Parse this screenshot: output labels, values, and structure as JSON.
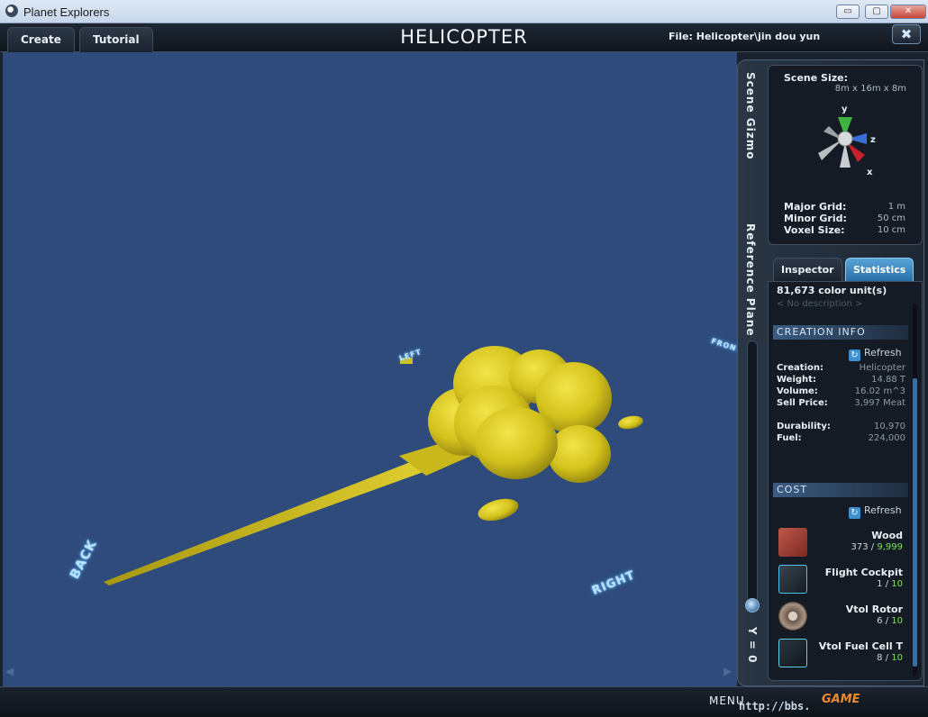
{
  "window": {
    "title": "Planet Explorers",
    "min": "▭",
    "max": "▢",
    "close": "✕"
  },
  "header": {
    "tabs": [
      "Create",
      "Tutorial"
    ],
    "title": "HELICOPTER",
    "file": "File:  Helicopter\\jin dou yun",
    "close": "✖"
  },
  "viewport": {
    "labels": {
      "back": "BACK",
      "right": "RIGHT",
      "left": "LEFT",
      "front": "FRONT"
    },
    "model_color": "#d4c21c",
    "background": "#2e4b7c"
  },
  "side_panel": {
    "vertical_labels": {
      "scene_gizmo": "Scene Gizmo",
      "reference_plane": "Reference Plane",
      "y_value": "Y = 0"
    },
    "gizmo": {
      "scene_size_label": "Scene Size:",
      "scene_size_value": "8m x 16m x 8m",
      "axes": {
        "y": "y",
        "z": "z",
        "x": "x"
      },
      "major_grid_label": "Major Grid:",
      "major_grid_value": "1 m",
      "minor_grid_label": "Minor Grid:",
      "minor_grid_value": "50 cm",
      "voxel_size_label": "Voxel Size:",
      "voxel_size_value": "10 cm"
    },
    "tabs": {
      "inspector": "Inspector",
      "statistics": "Statistics",
      "active": "statistics"
    },
    "stats": {
      "color_units": "81,673 color unit(s)",
      "description": "< No description >",
      "creation_header": "CREATION INFO",
      "refresh": "Refresh",
      "creation_label": "Creation:",
      "creation_value": "Helicopter",
      "weight_label": "Weight:",
      "weight_value": "14.88 T",
      "volume_label": "Volume:",
      "volume_value": "16.02 m^3",
      "sell_label": "Sell Price:",
      "sell_value": "3,997 Meat",
      "durability_label": "Durability:",
      "durability_value": "10,970",
      "fuel_label": "Fuel:",
      "fuel_value": "224,000",
      "cost_header": "COST",
      "cost_items": [
        {
          "name": "Wood",
          "have": "373",
          "sep": " / ",
          "need": "9,999",
          "icon": "wood-block-icon"
        },
        {
          "name": "Flight Cockpit",
          "have": "1",
          "sep": " / ",
          "need": "10",
          "icon": "flight-cockpit-icon"
        },
        {
          "name": "Vtol Rotor",
          "have": "6",
          "sep": " / ",
          "need": "10",
          "icon": "vtol-rotor-icon"
        },
        {
          "name": "Vtol Fuel Cell T",
          "have": "8",
          "sep": " / ",
          "need": "10",
          "icon": "fuel-cell-icon"
        }
      ]
    }
  },
  "bottom_bar": {
    "menu": "MENU",
    "watermark": "http://bbs.",
    "watermark_logo": "GAME"
  }
}
